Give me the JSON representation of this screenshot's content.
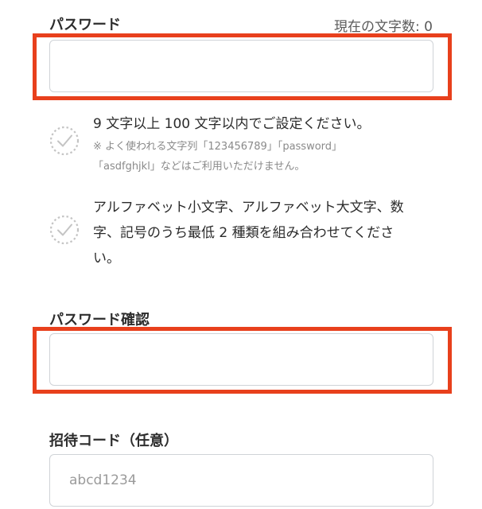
{
  "password": {
    "label": "パスワード",
    "counter": "現在の文字数: 0",
    "value": "",
    "placeholder": ""
  },
  "rules": [
    {
      "main": "9 文字以上 100 文字以内でご設定ください。",
      "note_line1": "※ よく使われる文字列「123456789」「password」",
      "note_line2": "「asdfghjkl」などはご利用いただけません。"
    },
    {
      "line1": "アルファベット小文字、アルファベット大文字、数",
      "line2": "字、記号のうち最低 2 種類を組み合わせてくださ",
      "line3": "い。"
    }
  ],
  "password_confirm": {
    "label": "パスワード確認",
    "value": "",
    "placeholder": ""
  },
  "invite_code": {
    "label": "招待コード（任意）",
    "value": "",
    "placeholder": "abcd1234"
  },
  "colors": {
    "highlight": "#e8401c",
    "check_icon": "#c4c4c4",
    "input_border": "#cfd3d7"
  }
}
